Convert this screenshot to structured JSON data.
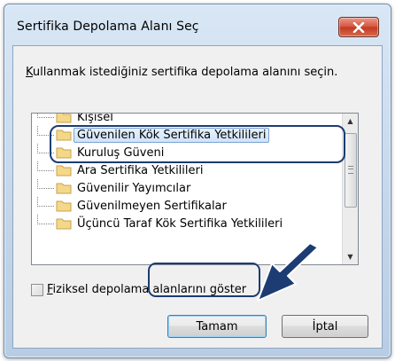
{
  "window": {
    "title": "Sertifika Depolama Alanı Seç",
    "close_label": "×"
  },
  "instruction": {
    "underlined": "K",
    "rest": "ullanmak istediğiniz sertifika depolama alanını seçin."
  },
  "tree": {
    "items": [
      {
        "label": "Kişisel",
        "selected": false
      },
      {
        "label": "Güvenilen Kök Sertifika Yetkilileri",
        "selected": true
      },
      {
        "label": "Kuruluş Güveni",
        "selected": false
      },
      {
        "label": "Ara Sertifika Yetkilileri",
        "selected": false
      },
      {
        "label": "Güvenilir Yayımcılar",
        "selected": false
      },
      {
        "label": "Güvenilmeyen Sertifikalar",
        "selected": false
      },
      {
        "label": "Üçüncü Taraf Kök Sertifika Yetkilileri",
        "selected": false
      }
    ]
  },
  "checkbox": {
    "underlined": "F",
    "rest": "iziksel depolama alanlarını göster",
    "checked": false
  },
  "buttons": {
    "ok": "Tamam",
    "cancel": "İptal"
  },
  "colors": {
    "annotation": "#1c3c73",
    "close_button": "#c8452d"
  }
}
